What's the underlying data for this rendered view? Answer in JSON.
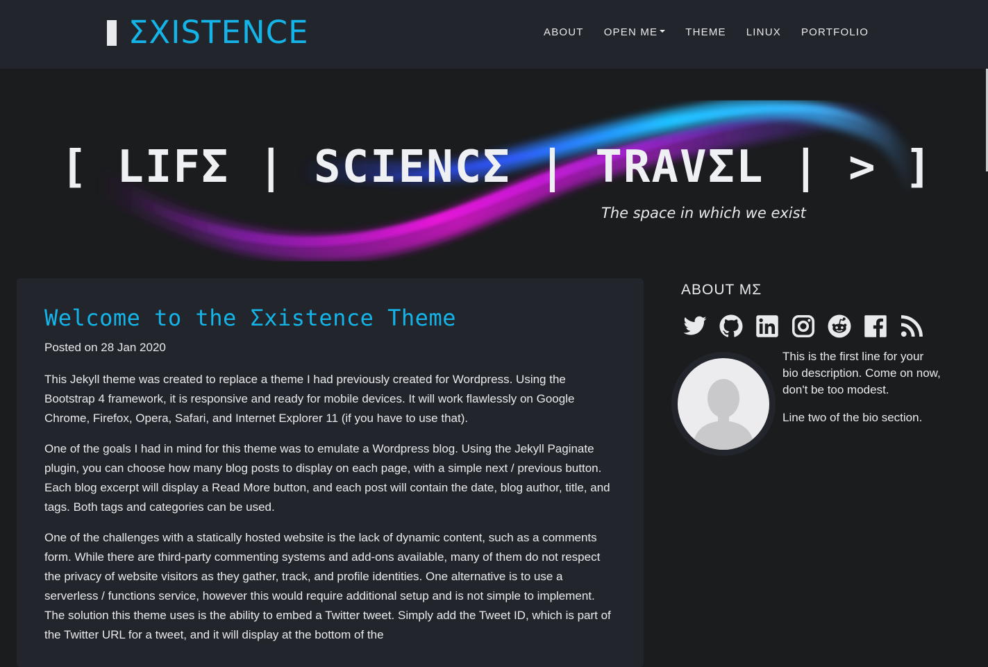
{
  "navbar": {
    "brand": "ΣXISTENCE",
    "items": [
      {
        "label": "ABOUT"
      },
      {
        "label": "OPEN ME",
        "dropdown": true
      },
      {
        "label": "THEME"
      },
      {
        "label": "LINUX"
      },
      {
        "label": "PORTFOLIO"
      }
    ]
  },
  "hero": {
    "title": "[ LIFΣ | SCIENCΣ | TRAVΣL | > ]",
    "subtitle": "The space in which we exist"
  },
  "post": {
    "title": "Welcome to the Σxistence Theme",
    "date": "Posted on 28 Jan 2020",
    "paragraphs": [
      "This Jekyll theme was created to replace a theme I had previously created for Wordpress. Using the Bootstrap 4 framework, it is responsive and ready for mobile devices. It will work flawlessly on Google Chrome, Firefox, Opera, Safari, and Internet Explorer 11 (if you have to use that).",
      "One of the goals I had in mind for this theme was to emulate a Wordpress blog. Using the Jekyll Paginate plugin, you can choose how many blog posts to display on each page, with a simple next / previous button. Each blog excerpt will display a Read More button, and each post will contain the date, blog author, title, and tags. Both tags and categories can be used.",
      "One of the challenges with a statically hosted website is the lack of dynamic content, such as a comments form. While there are third-party commenting systems and add-ons available, many of them do not respect the privacy of website visitors as they gather, track, and profile identities. One alternative is to use a serverless / functions service, however this would require additional setup and is not simple to implement. The solution this theme uses is the ability to embed a Twitter tweet. Simply add the Tweet ID, which is part of the Twitter URL for a tweet, and it will display at the bottom of the"
    ]
  },
  "sidebar": {
    "about_title": "ABOUT MΣ",
    "social_icons": [
      "twitter-icon",
      "github-icon",
      "linkedin-icon",
      "instagram-icon",
      "reddit-icon",
      "facebook-icon",
      "rss-icon"
    ],
    "bio": [
      "This is the first line for your bio description. Come on now, don't be too modest.",
      "Line two of the bio section."
    ]
  },
  "colors": {
    "accent": "#15b4e8",
    "background": "#1b1c1e",
    "panel": "#22262c",
    "text": "#e9eaec"
  }
}
